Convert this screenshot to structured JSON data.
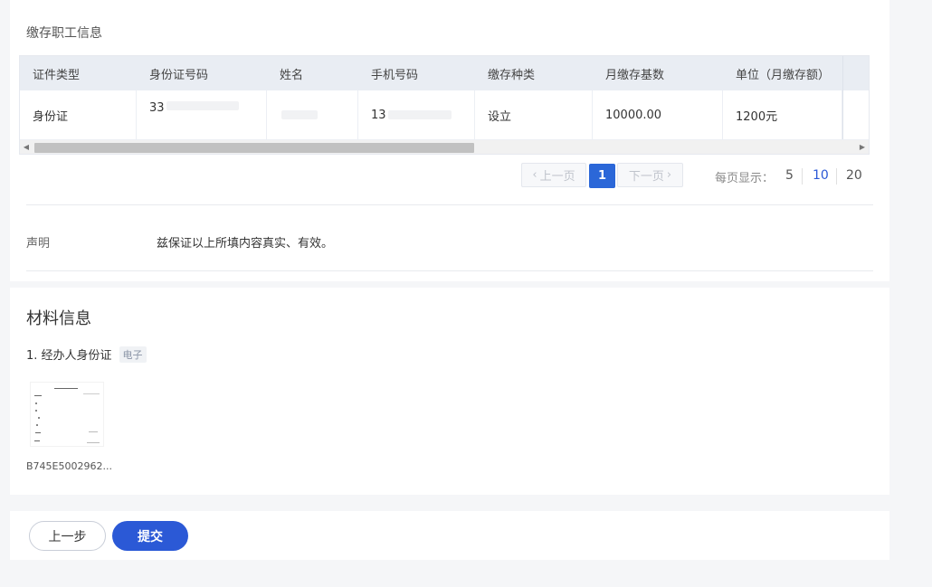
{
  "workers": {
    "section_label": "缴存职工信息",
    "columns": [
      "证件类型",
      "身份证号码",
      "姓名",
      "手机号码",
      "缴存种类",
      "月缴存基数",
      "单位（月缴存额）"
    ],
    "row": {
      "id_type": "身份证",
      "id_number": "33",
      "name": "",
      "phone": "13",
      "deposit_type": "设立",
      "monthly_base": "10000.00",
      "unit_amount": "1200元"
    }
  },
  "pagination": {
    "prev": "上一页",
    "current": "1",
    "next": "下一页",
    "per_page_label": "每页显示：",
    "options": [
      "5",
      "10",
      "20"
    ],
    "selected_option": "10"
  },
  "declaration": {
    "label": "声明",
    "text": "兹保证以上所填内容真实、有效。"
  },
  "materials": {
    "title": "材料信息",
    "item_label": "1. 经办人身份证",
    "item_tag": "电子",
    "file_name": "B745E5002962..."
  },
  "actions": {
    "prev_label": "上一步",
    "submit_label": "提交"
  },
  "colors": {
    "primary": "#2b59d6",
    "page_bg": "#f5f6f8",
    "table_header_bg": "#e9edf3"
  }
}
